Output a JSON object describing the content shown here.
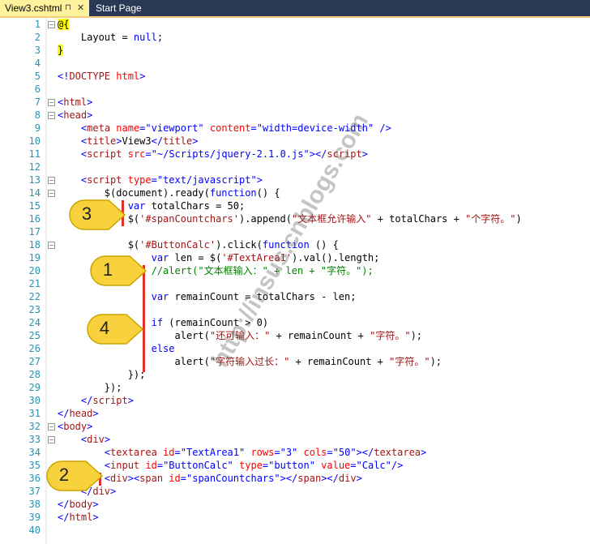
{
  "tabs": [
    {
      "label": "View3.cshtml",
      "active": true
    },
    {
      "label": "Start Page",
      "active": false
    }
  ],
  "code_lines": [
    {
      "n": "1",
      "fold": "minus",
      "parts": [
        [
          "dir",
          "@{"
        ]
      ]
    },
    {
      "n": "2",
      "parts": [
        [
          "",
          "    Layout = "
        ],
        [
          "k",
          "null"
        ],
        [
          "",
          ";"
        ]
      ]
    },
    {
      "n": "3",
      "parts": [
        [
          "dir",
          "}"
        ]
      ]
    },
    {
      "n": "4",
      "parts": []
    },
    {
      "n": "5",
      "parts": [
        [
          "k",
          "<!"
        ],
        [
          "tag",
          "DOCTYPE"
        ],
        [
          "",
          ""
        ],
        [
          "attr",
          " html"
        ],
        [
          "k",
          ">"
        ]
      ]
    },
    {
      "n": "6",
      "parts": []
    },
    {
      "n": "7",
      "fold": "minus",
      "parts": [
        [
          "k",
          "<"
        ],
        [
          "tag",
          "html"
        ],
        [
          "k",
          ">"
        ]
      ]
    },
    {
      "n": "8",
      "fold": "minus",
      "parts": [
        [
          "k",
          "<"
        ],
        [
          "tag",
          "head"
        ],
        [
          "k",
          ">"
        ]
      ]
    },
    {
      "n": "9",
      "parts": [
        [
          "",
          "    "
        ],
        [
          "k",
          "<"
        ],
        [
          "tag",
          "meta"
        ],
        [
          "attr",
          " name"
        ],
        [
          "k",
          "="
        ],
        [
          "k",
          "\"viewport\""
        ],
        [
          "attr",
          " content"
        ],
        [
          "k",
          "="
        ],
        [
          "k",
          "\"width=device-width\""
        ],
        [
          "k",
          " />"
        ]
      ]
    },
    {
      "n": "10",
      "parts": [
        [
          "",
          "    "
        ],
        [
          "k",
          "<"
        ],
        [
          "tag",
          "title"
        ],
        [
          "k",
          ">"
        ],
        [
          "",
          "View3"
        ],
        [
          "k",
          "</"
        ],
        [
          "tag",
          "title"
        ],
        [
          "k",
          ">"
        ]
      ]
    },
    {
      "n": "11",
      "parts": [
        [
          "",
          "    "
        ],
        [
          "k",
          "<"
        ],
        [
          "tag",
          "script"
        ],
        [
          "attr",
          " src"
        ],
        [
          "k",
          "="
        ],
        [
          "k",
          "\"~/Scripts/jquery-2.1.0.js\""
        ],
        [
          "k",
          "></"
        ],
        [
          "tag",
          "script"
        ],
        [
          "k",
          ">"
        ]
      ]
    },
    {
      "n": "12",
      "parts": []
    },
    {
      "n": "13",
      "fold": "minus",
      "parts": [
        [
          "",
          "    "
        ],
        [
          "k",
          "<"
        ],
        [
          "tag",
          "script"
        ],
        [
          "attr",
          " type"
        ],
        [
          "k",
          "="
        ],
        [
          "k",
          "\"text/javascript\""
        ],
        [
          "k",
          ">"
        ]
      ]
    },
    {
      "n": "14",
      "fold": "minus",
      "parts": [
        [
          "",
          "        $(document).ready("
        ],
        [
          "k",
          "function"
        ],
        [
          "",
          ""
        ],
        [
          "",
          "() {"
        ]
      ]
    },
    {
      "n": "15",
      "parts": [
        [
          "",
          "            "
        ],
        [
          "k",
          "var"
        ],
        [
          "",
          " totalChars = 50;"
        ]
      ]
    },
    {
      "n": "16",
      "parts": [
        [
          "",
          "            $("
        ],
        [
          "str",
          "'#spanCountchars'"
        ],
        [
          "",
          ").append("
        ],
        [
          "str",
          "\"文本框允许输入\""
        ],
        [
          "",
          " + totalChars + "
        ],
        [
          "str",
          "\"个字符。\""
        ],
        [
          "",
          ")"
        ]
      ]
    },
    {
      "n": "17",
      "parts": []
    },
    {
      "n": "18",
      "fold": "minus",
      "parts": [
        [
          "",
          "            $("
        ],
        [
          "str",
          "'#ButtonCalc'"
        ],
        [
          "",
          ").click("
        ],
        [
          "k",
          "function"
        ],
        [
          "",
          " () {"
        ]
      ]
    },
    {
      "n": "19",
      "parts": [
        [
          "",
          "                "
        ],
        [
          "k",
          "var"
        ],
        [
          "",
          " len = $("
        ],
        [
          "str",
          "'#TextArea1'"
        ],
        [
          "",
          ").val().length;"
        ]
      ]
    },
    {
      "n": "20",
      "parts": [
        [
          "",
          "                "
        ],
        [
          "cm",
          "//alert(\"文本框输入：\" + len + \"字符。\");"
        ]
      ]
    },
    {
      "n": "21",
      "parts": []
    },
    {
      "n": "22",
      "parts": [
        [
          "",
          "                "
        ],
        [
          "k",
          "var"
        ],
        [
          "",
          " remainCount = totalChars - len;"
        ]
      ]
    },
    {
      "n": "23",
      "parts": []
    },
    {
      "n": "24",
      "parts": [
        [
          "",
          "                "
        ],
        [
          "k",
          "if"
        ],
        [
          "",
          " (remainCount > 0)"
        ]
      ]
    },
    {
      "n": "25",
      "parts": [
        [
          "",
          "                    alert("
        ],
        [
          "str",
          "\"还可输入：\""
        ],
        [
          "",
          " + remainCount + "
        ],
        [
          "str",
          "\"字符。\""
        ],
        [
          "",
          ");"
        ]
      ]
    },
    {
      "n": "26",
      "parts": [
        [
          "",
          "                "
        ],
        [
          "k",
          "else"
        ]
      ]
    },
    {
      "n": "27",
      "parts": [
        [
          "",
          "                    alert("
        ],
        [
          "str",
          "\"字符输入过长：\""
        ],
        [
          "",
          " + remainCount + "
        ],
        [
          "str",
          "\"字符。\""
        ],
        [
          "",
          ");"
        ]
      ]
    },
    {
      "n": "28",
      "parts": [
        [
          "",
          "            });"
        ]
      ]
    },
    {
      "n": "29",
      "parts": [
        [
          "",
          "        });"
        ]
      ]
    },
    {
      "n": "30",
      "parts": [
        [
          "",
          "    "
        ],
        [
          "k",
          "</"
        ],
        [
          "tag",
          "script"
        ],
        [
          "k",
          ">"
        ]
      ]
    },
    {
      "n": "31",
      "parts": [
        [
          "k",
          "</"
        ],
        [
          "tag",
          "head"
        ],
        [
          "k",
          ">"
        ]
      ]
    },
    {
      "n": "32",
      "fold": "minus",
      "parts": [
        [
          "k",
          "<"
        ],
        [
          "tag",
          "body"
        ],
        [
          "k",
          ">"
        ]
      ]
    },
    {
      "n": "33",
      "fold": "minus",
      "parts": [
        [
          "",
          "    "
        ],
        [
          "k",
          "<"
        ],
        [
          "tag",
          "div"
        ],
        [
          "k",
          ">"
        ]
      ]
    },
    {
      "n": "34",
      "parts": [
        [
          "",
          "        "
        ],
        [
          "k",
          "<"
        ],
        [
          "tag",
          "textarea"
        ],
        [
          "attr",
          " id"
        ],
        [
          "k",
          "="
        ],
        [
          "k",
          "\"TextArea1\""
        ],
        [
          "attr",
          " rows"
        ],
        [
          "k",
          "="
        ],
        [
          "k",
          "\"3\""
        ],
        [
          "attr",
          " cols"
        ],
        [
          "k",
          "="
        ],
        [
          "k",
          "\"50\""
        ],
        [
          "k",
          "></"
        ],
        [
          "tag",
          "textarea"
        ],
        [
          "k",
          ">"
        ]
      ]
    },
    {
      "n": "35",
      "parts": [
        [
          "",
          "        "
        ],
        [
          "k",
          "<"
        ],
        [
          "tag",
          "input"
        ],
        [
          "attr",
          " id"
        ],
        [
          "k",
          "="
        ],
        [
          "k",
          "\"ButtonCalc\""
        ],
        [
          "attr",
          " type"
        ],
        [
          "k",
          "="
        ],
        [
          "k",
          "\"button\""
        ],
        [
          "attr",
          " value"
        ],
        [
          "k",
          "="
        ],
        [
          "k",
          "\"Calc\""
        ],
        [
          "k",
          "/>"
        ]
      ]
    },
    {
      "n": "36",
      "parts": [
        [
          "",
          "        "
        ],
        [
          "k",
          "<"
        ],
        [
          "tag",
          "div"
        ],
        [
          "k",
          "><"
        ],
        [
          "tag",
          "span"
        ],
        [
          "attr",
          " id"
        ],
        [
          "k",
          "="
        ],
        [
          "k",
          "\"spanCountchars\""
        ],
        [
          "k",
          "></"
        ],
        [
          "tag",
          "span"
        ],
        [
          "k",
          "></"
        ],
        [
          "tag",
          "div"
        ],
        [
          "k",
          ">"
        ]
      ]
    },
    {
      "n": "37",
      "parts": [
        [
          "",
          "    "
        ],
        [
          "k",
          "</"
        ],
        [
          "tag",
          "div"
        ],
        [
          "k",
          ">"
        ]
      ]
    },
    {
      "n": "38",
      "parts": [
        [
          "k",
          "</"
        ],
        [
          "tag",
          "body"
        ],
        [
          "k",
          ">"
        ]
      ]
    },
    {
      "n": "39",
      "parts": [
        [
          "k",
          "</"
        ],
        [
          "tag",
          "html"
        ],
        [
          "k",
          ">"
        ]
      ]
    },
    {
      "n": "40",
      "parts": []
    }
  ],
  "callouts": [
    {
      "label": "3"
    },
    {
      "label": "1"
    },
    {
      "label": "4"
    },
    {
      "label": "2"
    }
  ],
  "watermark": "http://insus.cnblogs.com"
}
